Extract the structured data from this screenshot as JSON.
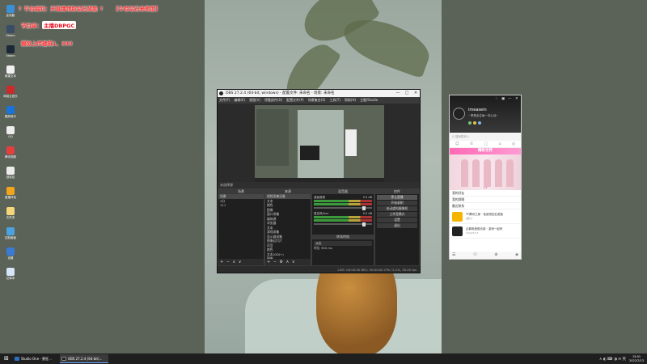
{
  "overlay": {
    "line1": "↑ 平台福利：开直播领取钻石奖励 ↑",
    "line1_right": "【今有钻石来密度】",
    "line2_label": "节目单：",
    "line2_value": "主播DBPGC",
    "line3": "模拟上传建筑1、333"
  },
  "desktop_icons": [
    {
      "label": "此电脑",
      "color": "#3b8fd6"
    },
    {
      "label": "Steam",
      "color": "#3a4c66"
    },
    {
      "label": "Steam",
      "color": "#1b2838"
    },
    {
      "label": "新建文本",
      "color": "#f0f0f0"
    },
    {
      "label": "网易云音乐",
      "color": "#cc2b2b"
    },
    {
      "label": "酷狗音乐",
      "color": "#1a73d9"
    },
    {
      "label": "QQ",
      "color": "#ededed"
    },
    {
      "label": "腾讯视频",
      "color": "#e43f3f"
    },
    {
      "label": "回收站",
      "color": "#ececec"
    },
    {
      "label": "直播伴侣",
      "color": "#f2a41d"
    },
    {
      "label": "文件夹",
      "color": "#f5d77a"
    },
    {
      "label": "控制面板",
      "color": "#4aa3e0"
    },
    {
      "label": "设置",
      "color": "#3a7bd5"
    },
    {
      "label": "记事本",
      "color": "#d6e6f7"
    }
  ],
  "obs": {
    "title": "OBS 27.2.4 (64-bit, windows) - 配置文件: 未命名 - 场景: 未命名",
    "window_controls": {
      "minimize": "—",
      "maximize": "□",
      "close": "✕"
    },
    "menu": [
      "文件(F)",
      "编辑(E)",
      "视图(V)",
      "停靠部件(D)",
      "配置文件(P)",
      "场景集合(S)",
      "工具(T)",
      "帮助(H)",
      "主题/Studio"
    ],
    "modebar": "未选择源",
    "panels": {
      "scenes": {
        "title": "场景",
        "items": [
          "场景",
          "2分",
          "111"
        ],
        "foot": "+ − ∧ ∨"
      },
      "sources": {
        "title": "来源",
        "items": [
          "视频采集设备",
          "文本",
          "颜色",
          "图像",
          "窗口采集",
          "媒体源",
          "浏览器",
          "文本",
          "游戏采集",
          "显示器采集",
          "图像幻灯片",
          "声音",
          "颜色",
          "文本(GDI+)",
          "图像"
        ],
        "foot": "+ − ⚙ ∧ ∨"
      },
      "mixer": {
        "title": "混音器",
        "tracks": [
          {
            "name": "桌面音频",
            "db": "0.0 dB"
          },
          {
            "name": "麦克风/Aux",
            "db": "0.0 dB"
          }
        ],
        "transition_title": "转场特效",
        "transition_value": "淡出",
        "duration_label": "时长",
        "duration_value": "300 ms"
      },
      "controls": {
        "title": "控件",
        "buttons": [
          "停止直播",
          "开始录制",
          "启动虚拟摄像机",
          "工作室模式",
          "设置",
          "退出"
        ]
      }
    },
    "status": "LIVE: 00:00:00   REC: 00:00:00   CPU: 2.1%, 30.00 fps"
  },
  "qq": {
    "window_controls": {
      "skin": "♢",
      "settings": "▣",
      "minimize": "—",
      "close": "✕"
    },
    "name": "imeasein",
    "signature": "~享受此生每一次心动~",
    "search_placeholder": "Q 搜索联系人",
    "tabs": [
      "☺",
      "✆",
      "▢",
      "⌂",
      "◎"
    ],
    "banner": "精彩世界",
    "banner_page": "1/3",
    "groups": [
      "我的好友",
      "我的群聊",
      "最近联系"
    ],
    "messages": [
      {
        "title": "TF腾讯之家 · 免费领钻石奖励",
        "sub": "[图片]",
        "color": "#f5b400"
      },
      {
        "title": "企鹅电竞俱乐部 · 游戏一起来",
        "sub": "2022/5/13",
        "color": "#222"
      }
    ],
    "footer": [
      "☰",
      "⚇",
      "⊕",
      "◈"
    ]
  },
  "taskbar": {
    "start": "⊞",
    "buttons": [
      {
        "label": "Studio One - 野狂...",
        "color": "#2b6fbf"
      },
      {
        "label": "OBS 27.2.4 (64-bit)...",
        "color": "#222"
      }
    ],
    "tray": "∧ ◐ ⌨ ◑ ✉ 英",
    "time": "15:01",
    "date": "2022/7/13"
  }
}
